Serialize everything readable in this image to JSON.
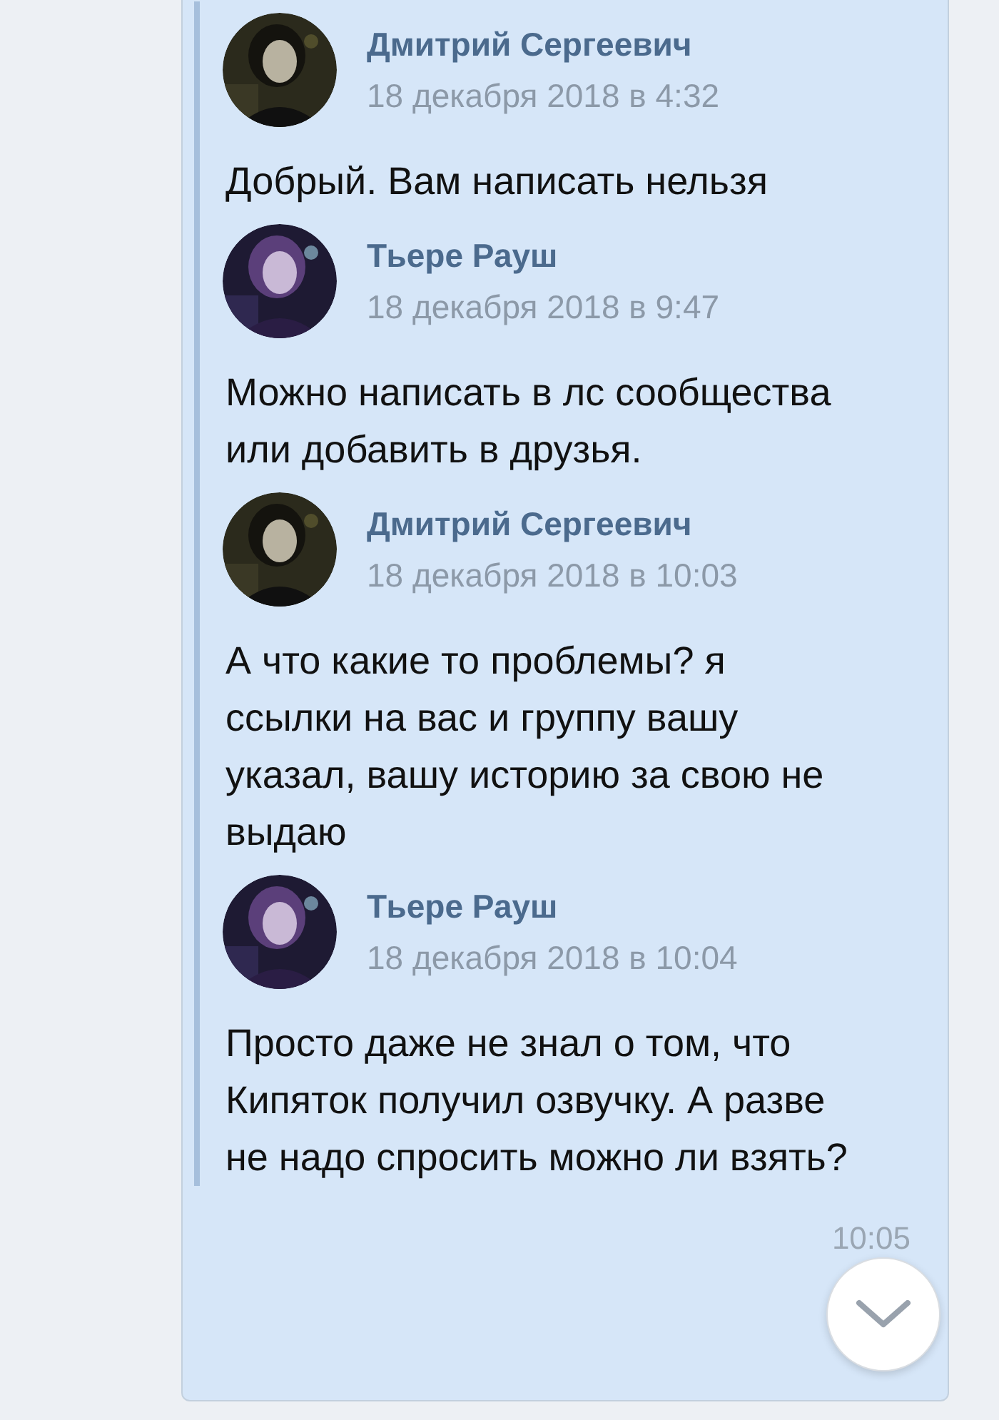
{
  "comments": [
    {
      "author": "Дмитрий Сергеевич",
      "date": "18 декабря 2018 в 4:32",
      "text": "Добрый. Вам написать нельзя"
    },
    {
      "author": "Тьере Рауш",
      "date": "18 декабря 2018 в 9:47",
      "text": "Можно написать в лс сообщества или добавить в друзья."
    },
    {
      "author": "Дмитрий Сергеевич",
      "date": "18 декабря 2018 в 10:03",
      "text": "А что какие то проблемы? я ссылки на вас и группу вашу указал, вашу историю за свою не выдаю"
    },
    {
      "author": "Тьере Рауш",
      "date": "18 декабря 2018 в 10:04",
      "text": "Просто даже не знал о том, что Кипяток получил озвучку. А разве не надо спросить можно ли взять?"
    }
  ],
  "message_time": "10:05"
}
